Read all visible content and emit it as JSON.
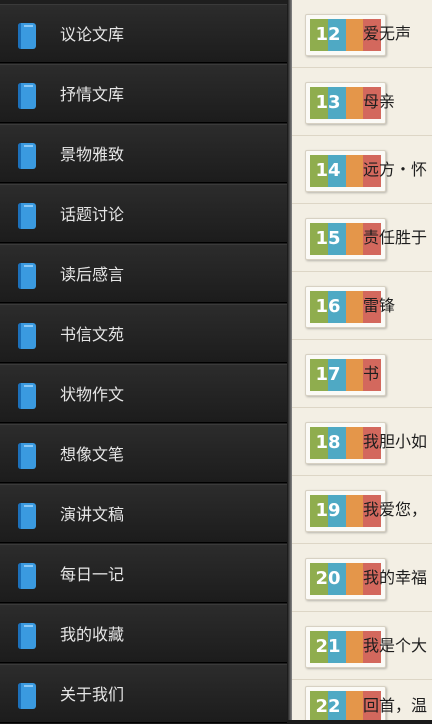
{
  "menu": {
    "items": [
      {
        "label": "议论文库",
        "icon": "book-icon"
      },
      {
        "label": "抒情文库",
        "icon": "book-icon"
      },
      {
        "label": "景物雅致",
        "icon": "book-icon"
      },
      {
        "label": "话题讨论",
        "icon": "book-icon"
      },
      {
        "label": "读后感言",
        "icon": "book-icon"
      },
      {
        "label": "书信文苑",
        "icon": "book-icon"
      },
      {
        "label": "状物作文",
        "icon": "book-icon"
      },
      {
        "label": "想像文笔",
        "icon": "book-icon"
      },
      {
        "label": "演讲文稿",
        "icon": "book-icon"
      },
      {
        "label": "每日一记",
        "icon": "book-icon"
      },
      {
        "label": "我的收藏",
        "icon": "book-icon"
      },
      {
        "label": "关于我们",
        "icon": "book-icon"
      }
    ]
  },
  "articles": [
    {
      "number": "12",
      "title": "爱无声"
    },
    {
      "number": "13",
      "title": "母亲"
    },
    {
      "number": "14",
      "title": "远方・怀"
    },
    {
      "number": "15",
      "title": "责任胜于"
    },
    {
      "number": "16",
      "title": "雷锋"
    },
    {
      "number": "17",
      "title": "书"
    },
    {
      "number": "18",
      "title": "我胆小如"
    },
    {
      "number": "19",
      "title": "我爱您，"
    },
    {
      "number": "20",
      "title": "我的幸福"
    },
    {
      "number": "21",
      "title": "我是个大"
    },
    {
      "number": "22",
      "title": "回首，温"
    }
  ],
  "colors": {
    "drawer_bg": "#1e1e1e",
    "content_bg": "#f3efe4",
    "stripe_green": "#8fad4e",
    "stripe_blue": "#4fa9c4",
    "stripe_orange": "#e4964a",
    "stripe_red": "#d3685d",
    "icon_blue": "#3a9ae0"
  }
}
